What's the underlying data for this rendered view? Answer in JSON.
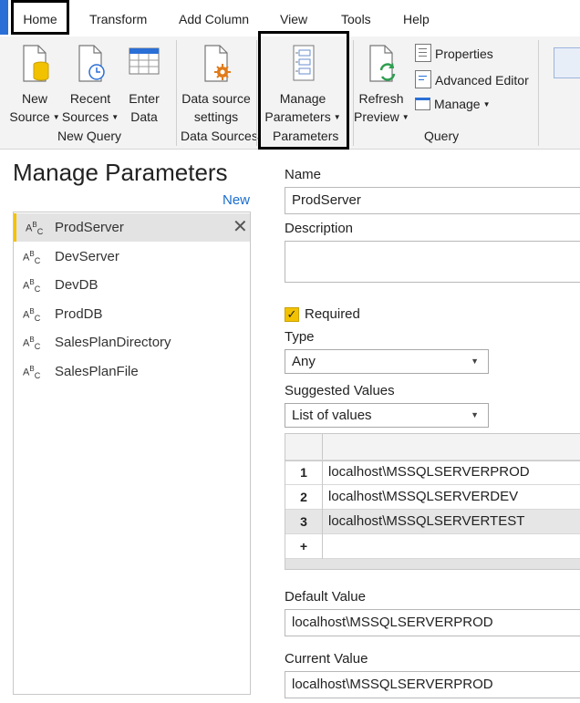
{
  "ribbon": {
    "tabs": [
      "Home",
      "Transform",
      "Add Column",
      "View",
      "Tools",
      "Help"
    ],
    "new_query": {
      "group": "New Query",
      "new_source": [
        "New",
        "Source"
      ],
      "recent_sources": [
        "Recent",
        "Sources"
      ],
      "enter_data": [
        "Enter",
        "Data"
      ]
    },
    "data_sources": {
      "group": "Data Sources",
      "data_source_settings": [
        "Data source",
        "settings"
      ]
    },
    "parameters": {
      "group": "Parameters",
      "manage_parameters": [
        "Manage",
        "Parameters"
      ]
    },
    "query": {
      "group": "Query",
      "refresh_preview": [
        "Refresh",
        "Preview"
      ],
      "properties": "Properties",
      "advanced_editor": "Advanced Editor",
      "manage": "Manage"
    }
  },
  "dialog": {
    "title": "Manage Parameters",
    "new_link": "New",
    "parameters": [
      "ProdServer",
      "DevServer",
      "DevDB",
      "ProdDB",
      "SalesPlanDirectory",
      "SalesPlanFile"
    ],
    "type_glyph": {
      "a": "A",
      "b": "B",
      "c": "C"
    },
    "form": {
      "name_label": "Name",
      "name_value": "ProdServer",
      "description_label": "Description",
      "description_value": "",
      "required_label": "Required",
      "type_label": "Type",
      "type_value": "Any",
      "suggested_label": "Suggested Values",
      "suggested_value": "List of values",
      "values_list": [
        {
          "n": "1",
          "v": "localhost\\MSSQLSERVERPROD"
        },
        {
          "n": "2",
          "v": "localhost\\MSSQLSERVERDEV"
        },
        {
          "n": "3",
          "v": "localhost\\MSSQLSERVERTEST"
        }
      ],
      "add_row": "+",
      "default_label": "Default Value",
      "default_value": "localhost\\MSSQLSERVERPROD",
      "current_label": "Current Value",
      "current_value": "localhost\\MSSQLSERVERPROD"
    }
  },
  "colors": {
    "accent_yellow": "#f2c200",
    "link_blue": "#1a6dcc",
    "tab_accent": "#2a6fd6"
  }
}
